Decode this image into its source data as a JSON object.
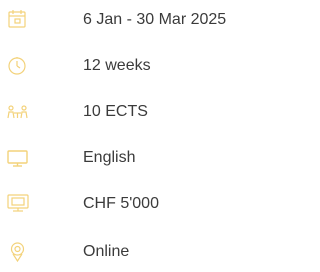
{
  "course_info": {
    "items": [
      {
        "icon": "calendar-icon",
        "text": "6 Jan - 30 Mar 2025"
      },
      {
        "icon": "clock-icon",
        "text": "12 weeks"
      },
      {
        "icon": "credits-icon",
        "text": "10 ECTS"
      },
      {
        "icon": "language-icon",
        "text": "English"
      },
      {
        "icon": "price-icon",
        "text": "CHF 5'000"
      },
      {
        "icon": "location-icon",
        "text": "Online"
      }
    ]
  },
  "colors": {
    "icon": "#f3d27a",
    "text": "#3b3b3b",
    "background": "#ffffff"
  }
}
